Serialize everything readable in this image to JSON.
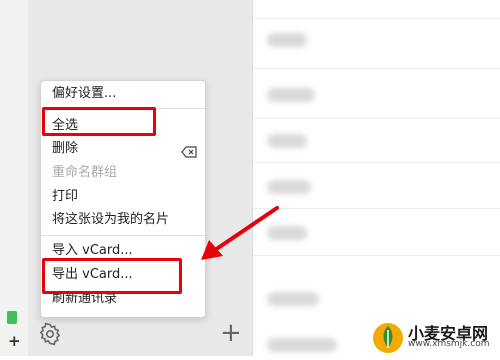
{
  "menu": {
    "items": [
      {
        "label": "偏好设置...",
        "enabled": true
      },
      {
        "label": "全选",
        "enabled": true
      },
      {
        "label": "删除",
        "enabled": true
      },
      {
        "label": "重命名群组",
        "enabled": false
      },
      {
        "label": "打印",
        "enabled": true
      },
      {
        "label": "将这张设为我的名片",
        "enabled": true
      },
      {
        "label": "导入 vCard...",
        "enabled": true
      },
      {
        "label": "导出 vCard...",
        "enabled": true
      },
      {
        "label": "刷新通讯录",
        "enabled": true
      }
    ],
    "highlighted": [
      "全选",
      "导出 vCard..."
    ]
  },
  "toolbar": {
    "plus_label": "+",
    "left_plus_label": "+"
  },
  "icons": {
    "settings": "gear-icon",
    "delete_key": "delete-key-icon",
    "add": "plus-icon",
    "annotation": "red-arrow-icon"
  },
  "watermark": {
    "title": "小麦安卓网",
    "url": "www.xmsmjk.com"
  },
  "colors": {
    "highlight": "#e8000b",
    "pane_bg": "#e8e8e8",
    "strip_icon": "#3fbf5f"
  }
}
